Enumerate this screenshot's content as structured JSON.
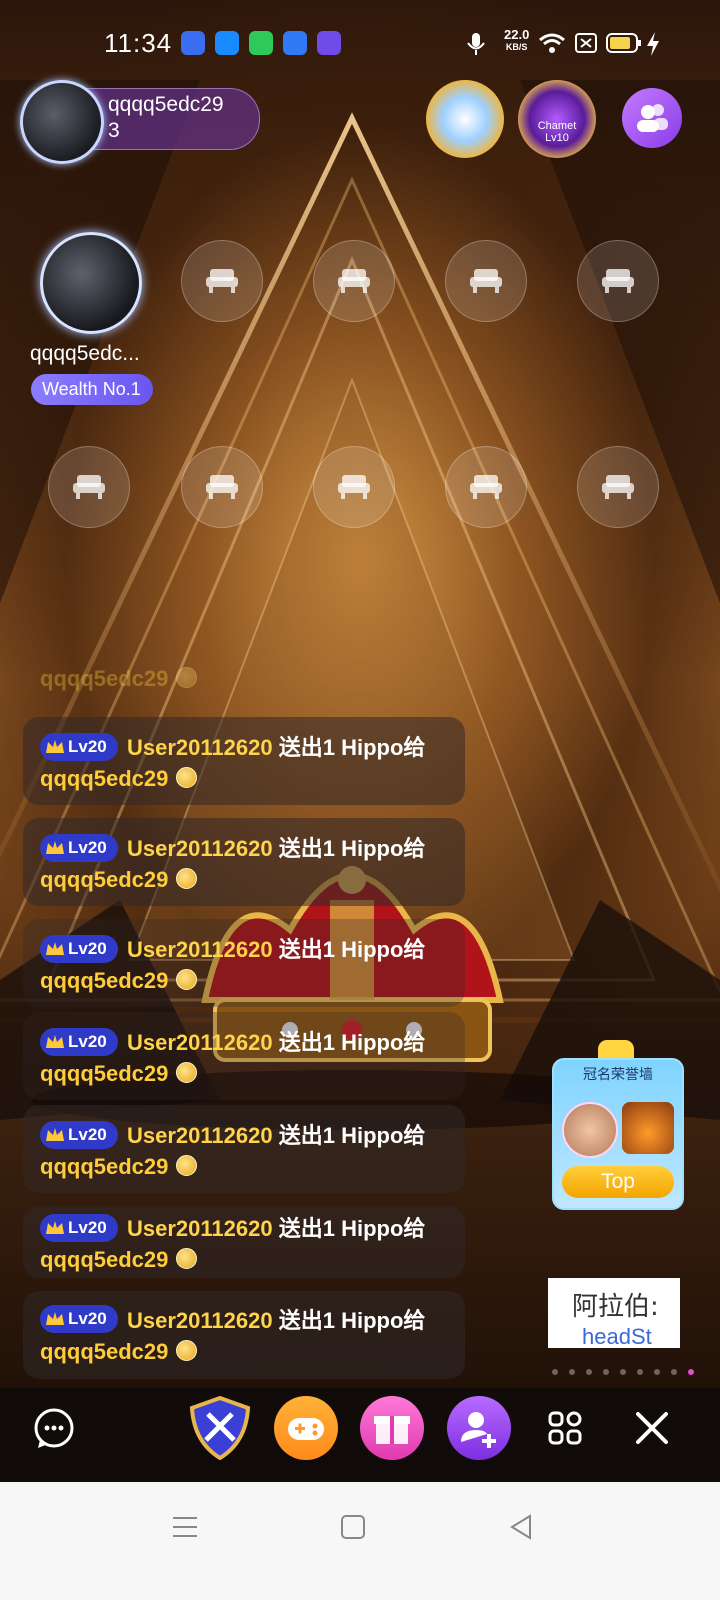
{
  "status_bar": {
    "time": "11:34",
    "net_speed_value": "22.0",
    "net_speed_unit": "KB/S",
    "notification_icons": [
      "baidu-icon",
      "video-icon",
      "android-icon",
      "cloud-icon",
      "app-icon"
    ],
    "system_icons": [
      "mic-icon",
      "wifi-icon",
      "sim-icon",
      "battery-icon",
      "charging-icon"
    ]
  },
  "header": {
    "host_name": "qqqq5edc29",
    "host_count": "3",
    "badges": [
      "eagle-lv-badge",
      "chamet-lv-badge"
    ],
    "chamet_badge_label": "Chamet",
    "chamet_badge_level": "Lv10"
  },
  "seats": {
    "occupied": {
      "name": "qqqq5edc...",
      "badge": "Wealth No.1"
    },
    "empty_count": 9
  },
  "chat": {
    "partial_line": "qqqq5edc29",
    "messages": [
      {
        "level": "Lv20",
        "user": "User20112620",
        "action": "送出1 Hippo给",
        "target": "qqqq5edc29"
      },
      {
        "level": "Lv20",
        "user": "User20112620",
        "action": "送出1 Hippo给",
        "target": "qqqq5edc29"
      },
      {
        "level": "Lv20",
        "user": "User20112620",
        "action": "送出1 Hippo给",
        "target": "qqqq5edc29"
      },
      {
        "level": "Lv20",
        "user": "User20112620",
        "action": "送出1 Hippo给",
        "target": "qqqq5edc29"
      },
      {
        "level": "Lv20",
        "user": "User20112620",
        "action": "送出1 Hippo给",
        "target": "qqqq5edc29"
      },
      {
        "level": "Lv20",
        "user": "User20112620",
        "action": "送出1 Hippo给",
        "target": "qqqq5edc29"
      },
      {
        "level": "Lv20",
        "user": "User20112620",
        "action": "送出1 Hippo给",
        "target": "qqqq5edc29"
      }
    ]
  },
  "honor_wall": {
    "title": "冠名荣誉墙",
    "button": "Top"
  },
  "ad_card": {
    "text": "阿拉伯:",
    "subtext": "headSt"
  },
  "bottom_bar": {
    "buttons": [
      "chat-icon",
      "shield-icon",
      "game-icon",
      "gift-icon",
      "add-user-icon",
      "grid-icon",
      "close-icon"
    ]
  },
  "colors": {
    "username": "#ffd34a",
    "level_badge": "#2f3ac9",
    "accent_purple": "#8a3ce6",
    "gold": "#f5a300"
  }
}
